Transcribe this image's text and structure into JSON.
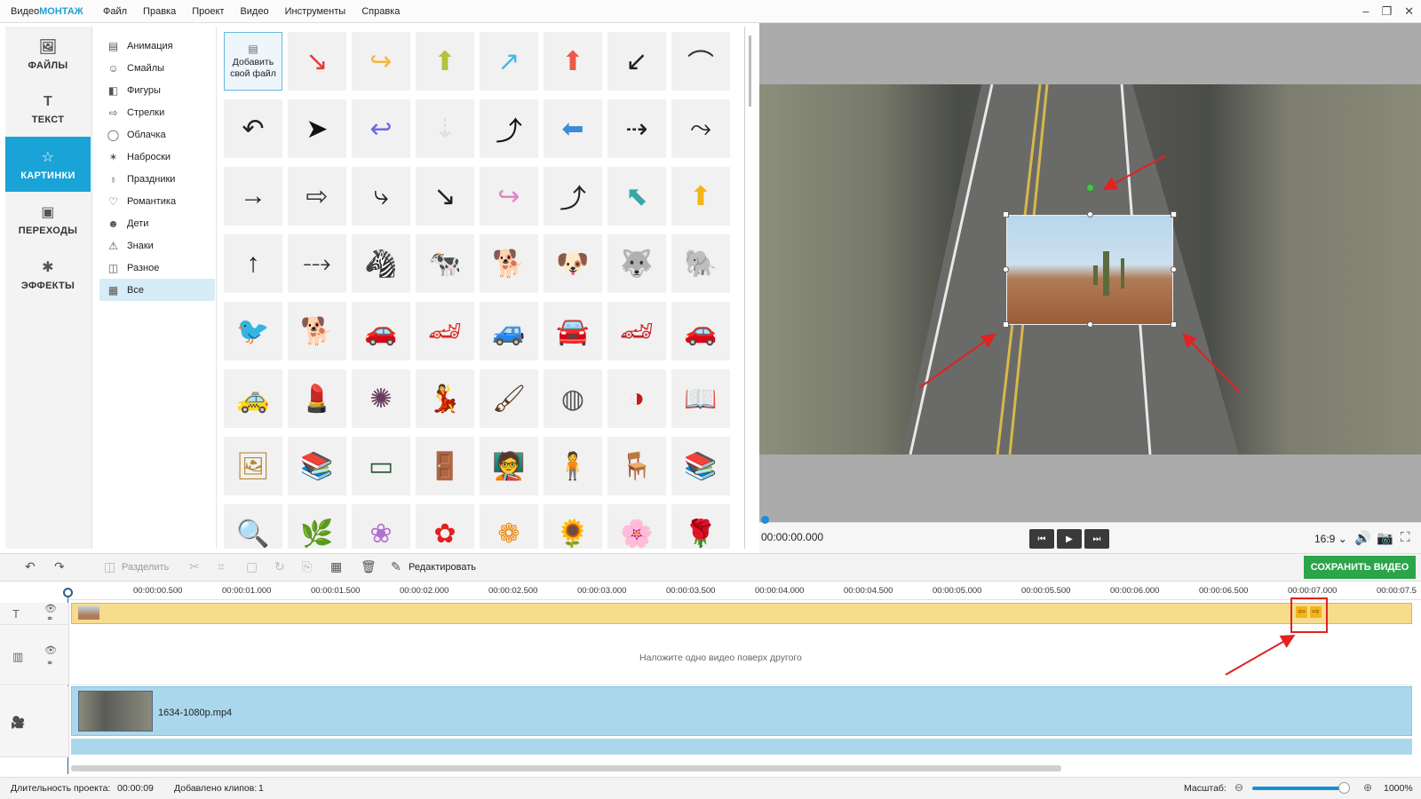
{
  "app": {
    "logo_prefix": "Видео",
    "logo_accent": "МОНТАЖ"
  },
  "menu": [
    "Файл",
    "Правка",
    "Проект",
    "Видео",
    "Инструменты",
    "Справка"
  ],
  "window_controls": [
    "–",
    "❐",
    "✕"
  ],
  "leftnav": [
    {
      "label": "ФАЙЛЫ",
      "icon": "image-icon",
      "glyph": "🖼"
    },
    {
      "label": "ТЕКСТ",
      "icon": "text-icon",
      "glyph": "T"
    },
    {
      "label": "КАРТИНКИ",
      "icon": "star-icon",
      "glyph": "☆",
      "active": true
    },
    {
      "label": "ПЕРЕХОДЫ",
      "icon": "transitions-icon",
      "glyph": "▣"
    },
    {
      "label": "ЭФФЕКТЫ",
      "icon": "effects-icon",
      "glyph": "✱"
    }
  ],
  "categories": [
    {
      "label": "Анимация",
      "icon": "film-icon",
      "glyph": "▤"
    },
    {
      "label": "Смайлы",
      "icon": "smile-icon",
      "glyph": "☺"
    },
    {
      "label": "Фигуры",
      "icon": "shapes-icon",
      "glyph": "◧"
    },
    {
      "label": "Стрелки",
      "icon": "arrow-icon",
      "glyph": "⇨"
    },
    {
      "label": "Облачка",
      "icon": "bubble-icon",
      "glyph": "◯"
    },
    {
      "label": "Наброски",
      "icon": "sketch-icon",
      "glyph": "✶"
    },
    {
      "label": "Праздники",
      "icon": "balloon-icon",
      "glyph": "♁"
    },
    {
      "label": "Романтика",
      "icon": "heart-icon",
      "glyph": "♡"
    },
    {
      "label": "Дети",
      "icon": "child-icon",
      "glyph": "☻"
    },
    {
      "label": "Знаки",
      "icon": "warning-icon",
      "glyph": "⚠"
    },
    {
      "label": "Разное",
      "icon": "misc-icon",
      "glyph": "◫"
    },
    {
      "label": "Все",
      "icon": "grid-icon",
      "glyph": "▦",
      "active": true
    }
  ],
  "gallery": {
    "add_file_label": "Добавить свой файл",
    "tiles": [
      {
        "name": "red-zigzag-arrow",
        "glyph": "↘",
        "color": "#e33b3b"
      },
      {
        "name": "yellow-curved-arrow",
        "glyph": "↪",
        "color": "#f2b840"
      },
      {
        "name": "green-up-arrow",
        "glyph": "⬆",
        "color": "#b4c23a"
      },
      {
        "name": "blue-trend-arrow",
        "glyph": "↗",
        "color": "#49b8e0"
      },
      {
        "name": "red-up-arrow",
        "glyph": "⬆",
        "color": "#ea5a4a"
      },
      {
        "name": "sketch-curved-arrow",
        "glyph": "↙",
        "color": "#222"
      },
      {
        "name": "thin-curve-arrow",
        "glyph": "⌒",
        "color": "#333"
      },
      {
        "name": "undo-curve-arrow",
        "glyph": "↶",
        "color": "#222"
      },
      {
        "name": "cursor-click-arrow",
        "glyph": "➤",
        "color": "#111"
      },
      {
        "name": "purple-hook-arrow",
        "glyph": "↩",
        "color": "#6e6ae0"
      },
      {
        "name": "dotted-down-arrow",
        "glyph": "⇣",
        "color": "#e0e0e0"
      },
      {
        "name": "black-swoosh-arrow",
        "glyph": "⤴",
        "color": "#111"
      },
      {
        "name": "blue-left-arrow",
        "glyph": "⬅",
        "color": "#3b8bd8"
      },
      {
        "name": "dashed-right-arrow",
        "glyph": "⇢",
        "color": "#222"
      },
      {
        "name": "dotted-curve-arrow",
        "glyph": "⤳",
        "color": "#222"
      },
      {
        "name": "right-arrow",
        "glyph": "→",
        "color": "#222"
      },
      {
        "name": "outline-right-arrow",
        "glyph": "⇨",
        "color": "#333"
      },
      {
        "name": "curved-down-right-arrow",
        "glyph": "⤷",
        "color": "#222"
      },
      {
        "name": "long-curve-arrow",
        "glyph": "↘",
        "color": "#222"
      },
      {
        "name": "pink-curve-arrow",
        "glyph": "↪",
        "color": "#e184c8"
      },
      {
        "name": "u-turn-arrow",
        "glyph": "⤴",
        "color": "#222"
      },
      {
        "name": "teal-diagonal-arrow",
        "glyph": "⬉",
        "color": "#3aa7a7"
      },
      {
        "name": "yellow-up-arrow",
        "glyph": "⬆",
        "color": "#f4b418"
      },
      {
        "name": "thin-up-arrow",
        "glyph": "↑",
        "color": "#222"
      },
      {
        "name": "dotted-diagonal-arrow",
        "glyph": "⤏",
        "color": "#333"
      },
      {
        "name": "zebra-picture",
        "glyph": "🦓",
        "color": "#222"
      },
      {
        "name": "cow-picture",
        "glyph": "🐄",
        "color": "#222"
      },
      {
        "name": "collie-dog-picture",
        "glyph": "🐕",
        "color": "#b06a2c"
      },
      {
        "name": "dalmatian-cartoon-picture",
        "glyph": "🐶",
        "color": "#222"
      },
      {
        "name": "husky-dog-picture",
        "glyph": "🐺",
        "color": "#333"
      },
      {
        "name": "elephant-picture",
        "glyph": "🐘",
        "color": "#6f7b6a"
      },
      {
        "name": "purple-bird-picture",
        "glyph": "🐦",
        "color": "#8a4cc8"
      },
      {
        "name": "cartoon-dog-picture",
        "glyph": "🐕",
        "color": "#c48a30"
      },
      {
        "name": "orange-car-picture",
        "glyph": "🚗",
        "color": "#e5661c"
      },
      {
        "name": "red-sports-car-picture",
        "glyph": "🏎",
        "color": "#d9261c"
      },
      {
        "name": "blue-car-picture",
        "glyph": "🚙",
        "color": "#4aa6d8"
      },
      {
        "name": "white-car-picture",
        "glyph": "🚘",
        "color": "#999"
      },
      {
        "name": "red-racing-car-picture",
        "glyph": "🏎",
        "color": "#c4222a"
      },
      {
        "name": "green-car-picture",
        "glyph": "🚗",
        "color": "#2e8a2c"
      },
      {
        "name": "yellow-car-picture",
        "glyph": "🚕",
        "color": "#e8b820"
      },
      {
        "name": "lipsticks-picture",
        "glyph": "💄",
        "color": "#c0392b"
      },
      {
        "name": "eyeshadow-palette-picture",
        "glyph": "✺",
        "color": "#6a3c5c"
      },
      {
        "name": "woman-figure-picture",
        "glyph": "💃",
        "color": "#c0392b"
      },
      {
        "name": "makeup-brush-picture",
        "glyph": "🖌",
        "color": "#5a3a22"
      },
      {
        "name": "compact-powder-picture",
        "glyph": "◍",
        "color": "#555"
      },
      {
        "name": "makeup-kit-picture",
        "glyph": "◑",
        "color": "#c01c1c"
      },
      {
        "name": "open-book-picture",
        "glyph": "📖",
        "color": "#777"
      },
      {
        "name": "picture-frame-picture",
        "glyph": "🖼",
        "color": "#b58a3a"
      },
      {
        "name": "book-stack-picture",
        "glyph": "📚",
        "color": "#4a6a9a"
      },
      {
        "name": "chalkboard-picture",
        "glyph": "▭",
        "color": "#2f5a3a"
      },
      {
        "name": "door-figure-picture",
        "glyph": "🚪",
        "color": "#6a7a8a"
      },
      {
        "name": "teacher-board-picture",
        "glyph": "🧑‍🏫",
        "color": "#444"
      },
      {
        "name": "businesswoman-picture",
        "glyph": "🧍",
        "color": "#222"
      },
      {
        "name": "desk-worker-picture",
        "glyph": "🪑",
        "color": "#3a2a1a"
      },
      {
        "name": "books-tower-picture",
        "glyph": "📚",
        "color": "#8a5a2a"
      },
      {
        "name": "magnifier-picture",
        "glyph": "🔍",
        "color": "#6a6a8a"
      },
      {
        "name": "plant-picture",
        "glyph": "🌿",
        "color": "#3a6a2a"
      },
      {
        "name": "purple-flower-picture",
        "glyph": "❀",
        "color": "#b070d0"
      },
      {
        "name": "red-flower-picture",
        "glyph": "✿",
        "color": "#e02020"
      },
      {
        "name": "orange-gerbera-picture",
        "glyph": "❁",
        "color": "#f08a10"
      },
      {
        "name": "sunflower-picture",
        "glyph": "🌻",
        "color": "#e8a810"
      },
      {
        "name": "pink-rose-picture",
        "glyph": "🌸",
        "color": "#e47aa0"
      },
      {
        "name": "red-rose-picture",
        "glyph": "🌹",
        "color": "#c01828"
      }
    ]
  },
  "player": {
    "timecode": "00:00:00.000",
    "ratio": "16:9 ⌄"
  },
  "toolbar": {
    "split_label": "Разделить",
    "edit_label": "Редактировать",
    "save_label": "СОХРАНИТЬ ВИДЕО"
  },
  "timeline": {
    "ticks": [
      "00:00:00.500",
      "00:00:01.000",
      "00:00:01.500",
      "00:00:02.000",
      "00:00:02.500",
      "00:00:03.000",
      "00:00:03.500",
      "00:00:04.000",
      "00:00:04.500",
      "00:00:05.000",
      "00:00:05.500",
      "00:00:06.000",
      "00:00:06.500",
      "00:00:07.000",
      "00:00:07.5"
    ],
    "overlay_hint": "Наложите одно видео поверх другого",
    "clip_name": "1634-1080p.mp4"
  },
  "status": {
    "duration_label": "Длительность проекта:",
    "duration_value": "00:00:09",
    "clips_label": "Добавлено клипов:",
    "clips_value": "1",
    "zoom_label": "Масштаб:",
    "zoom_value": "1000%"
  }
}
